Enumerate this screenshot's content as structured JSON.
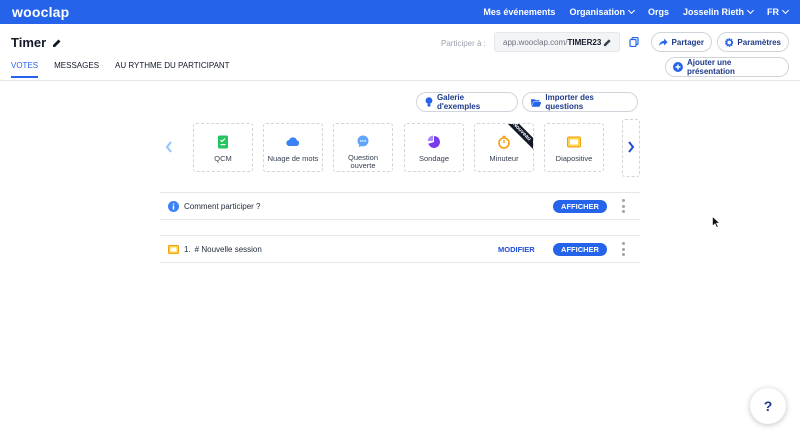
{
  "topbar": {
    "logo": "wooclap",
    "nav": [
      {
        "label": "Mes événements",
        "has_chevron": false
      },
      {
        "label": "Organisation",
        "has_chevron": true
      },
      {
        "label": "Orgs",
        "has_chevron": false
      },
      {
        "label": "Josselin Rieth",
        "has_chevron": true
      },
      {
        "label": "FR",
        "has_chevron": true
      }
    ]
  },
  "header": {
    "title": "Timer",
    "participate_label": "Participer à :",
    "url_prefix": "app.wooclap.com/",
    "url_code": "TIMER23",
    "share_label": "Partager",
    "settings_label": "Paramètres",
    "add_presentation_label": "Ajouter une présentation"
  },
  "tabs": [
    {
      "label": "VOTES",
      "active": true
    },
    {
      "label": "MESSAGES",
      "active": false
    },
    {
      "label": "AU RYTHME DU PARTICIPANT",
      "active": false
    }
  ],
  "actions": {
    "gallery_label": "Galerie d'exemples",
    "import_label": "Importer des questions"
  },
  "question_types": [
    {
      "label": "QCM",
      "icon": "qcm-icon",
      "color": "#22c55e"
    },
    {
      "label": "Nuage de mots",
      "icon": "cloud-icon",
      "color": "#3b82f6"
    },
    {
      "label": "Question ouverte",
      "icon": "chat-bubble-icon",
      "color": "#60a5fa"
    },
    {
      "label": "Sondage",
      "icon": "pie-chart-icon",
      "color": "#7c3aed"
    },
    {
      "label": "Minuteur",
      "icon": "stopwatch-icon",
      "color": "#f59e0b",
      "badge": "Nouveau"
    },
    {
      "label": "Diapositive",
      "icon": "slide-icon",
      "color": "#f59e0b"
    }
  ],
  "rows": {
    "info": {
      "text": "Comment participer ?",
      "show_label": "AFFICHER"
    },
    "session": {
      "number": "1.",
      "text": "# Nouvelle session",
      "modify_label": "MODIFIER",
      "show_label": "AFFICHER"
    }
  },
  "help": {
    "label": "?"
  },
  "colors": {
    "brand": "#2563eb",
    "text_dark": "#1e3a8a"
  }
}
